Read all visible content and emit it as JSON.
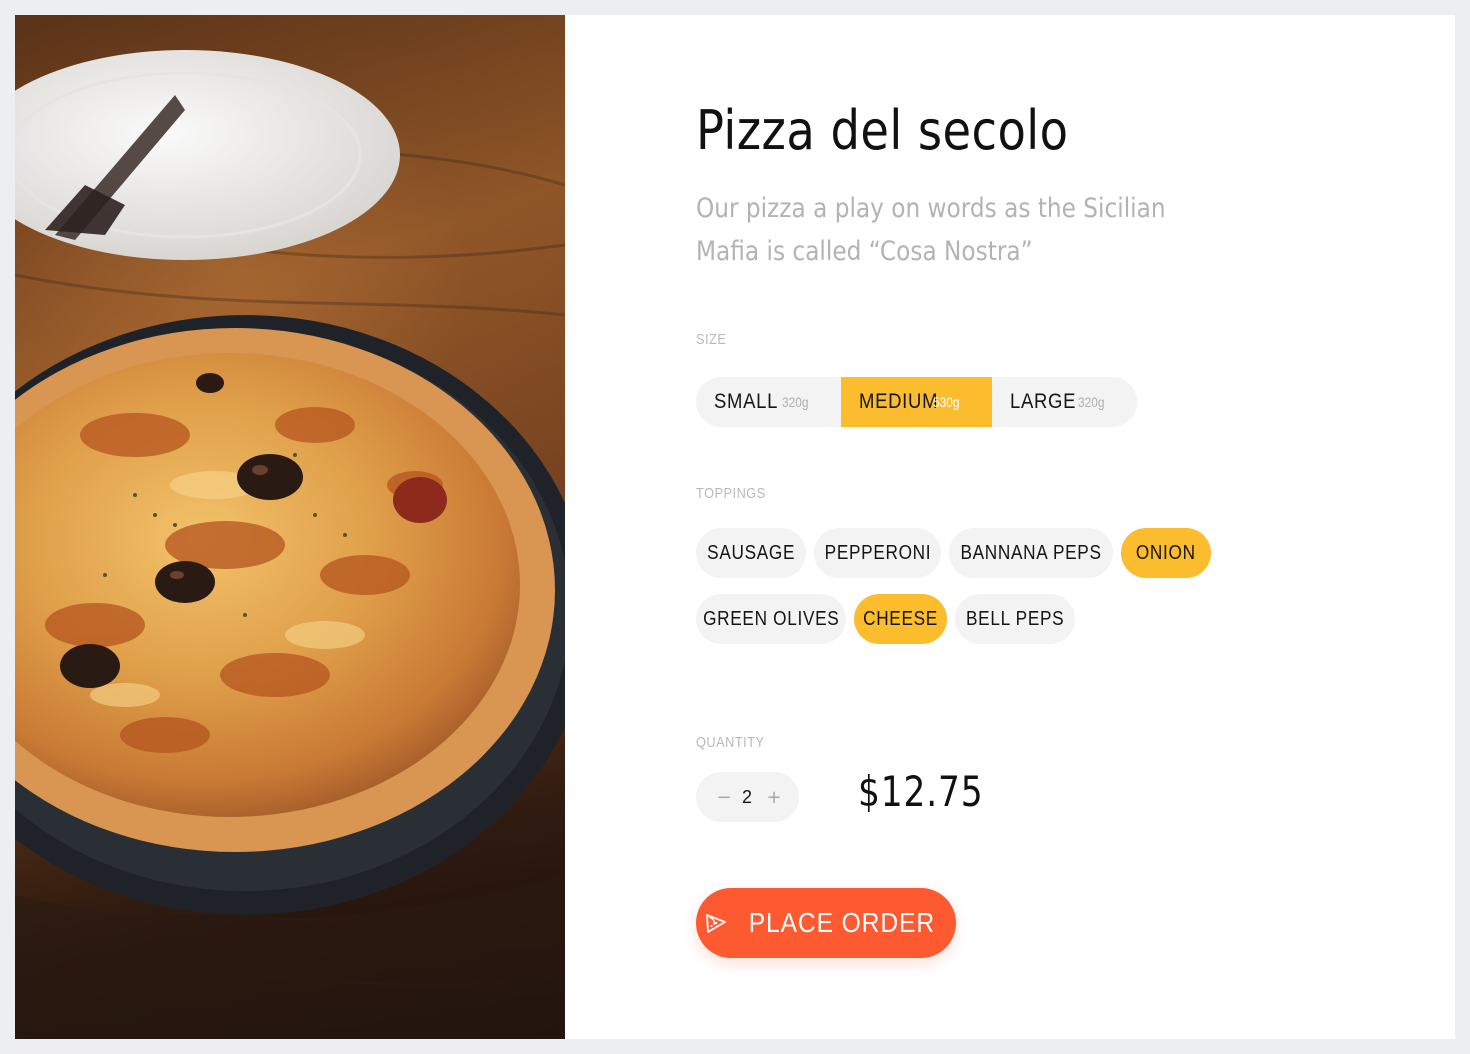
{
  "product": {
    "title": "Pizza del secolo",
    "description": "Our pizza a play on words as the Sicilian Mafia is called “Cosa Nostra”",
    "image_alt": "pizza on a dark pan with a plate in the background"
  },
  "size": {
    "label": "SIZE",
    "selected": "MEDIUM",
    "options": [
      {
        "name": "SMALL",
        "weight": "320g"
      },
      {
        "name": "MEDIUM",
        "weight": "530g"
      },
      {
        "name": "LARGE",
        "weight": "320g"
      }
    ]
  },
  "toppings": {
    "label": "TOPPINGS",
    "items": [
      {
        "name": "SAUSAGE",
        "selected": false
      },
      {
        "name": "PEPPERONI",
        "selected": false
      },
      {
        "name": "BANNANA PEPS",
        "selected": false
      },
      {
        "name": "ONION",
        "selected": true
      },
      {
        "name": "GREEN OLIVES",
        "selected": false
      },
      {
        "name": "CHEESE",
        "selected": true
      },
      {
        "name": "BELL PEPS",
        "selected": false
      }
    ]
  },
  "quantity": {
    "label": "QUANTITY",
    "minus": "−",
    "value": "2",
    "plus": "+"
  },
  "price": "$12.75",
  "order_button": {
    "label": "PLACE ORDER",
    "icon": "pizza-slice-icon"
  },
  "colors": {
    "accent_selected": "#fbbd2e",
    "order_button": "#fd5a32",
    "chip_bg": "#f3f3f3",
    "page_bg": "#eceef1"
  }
}
